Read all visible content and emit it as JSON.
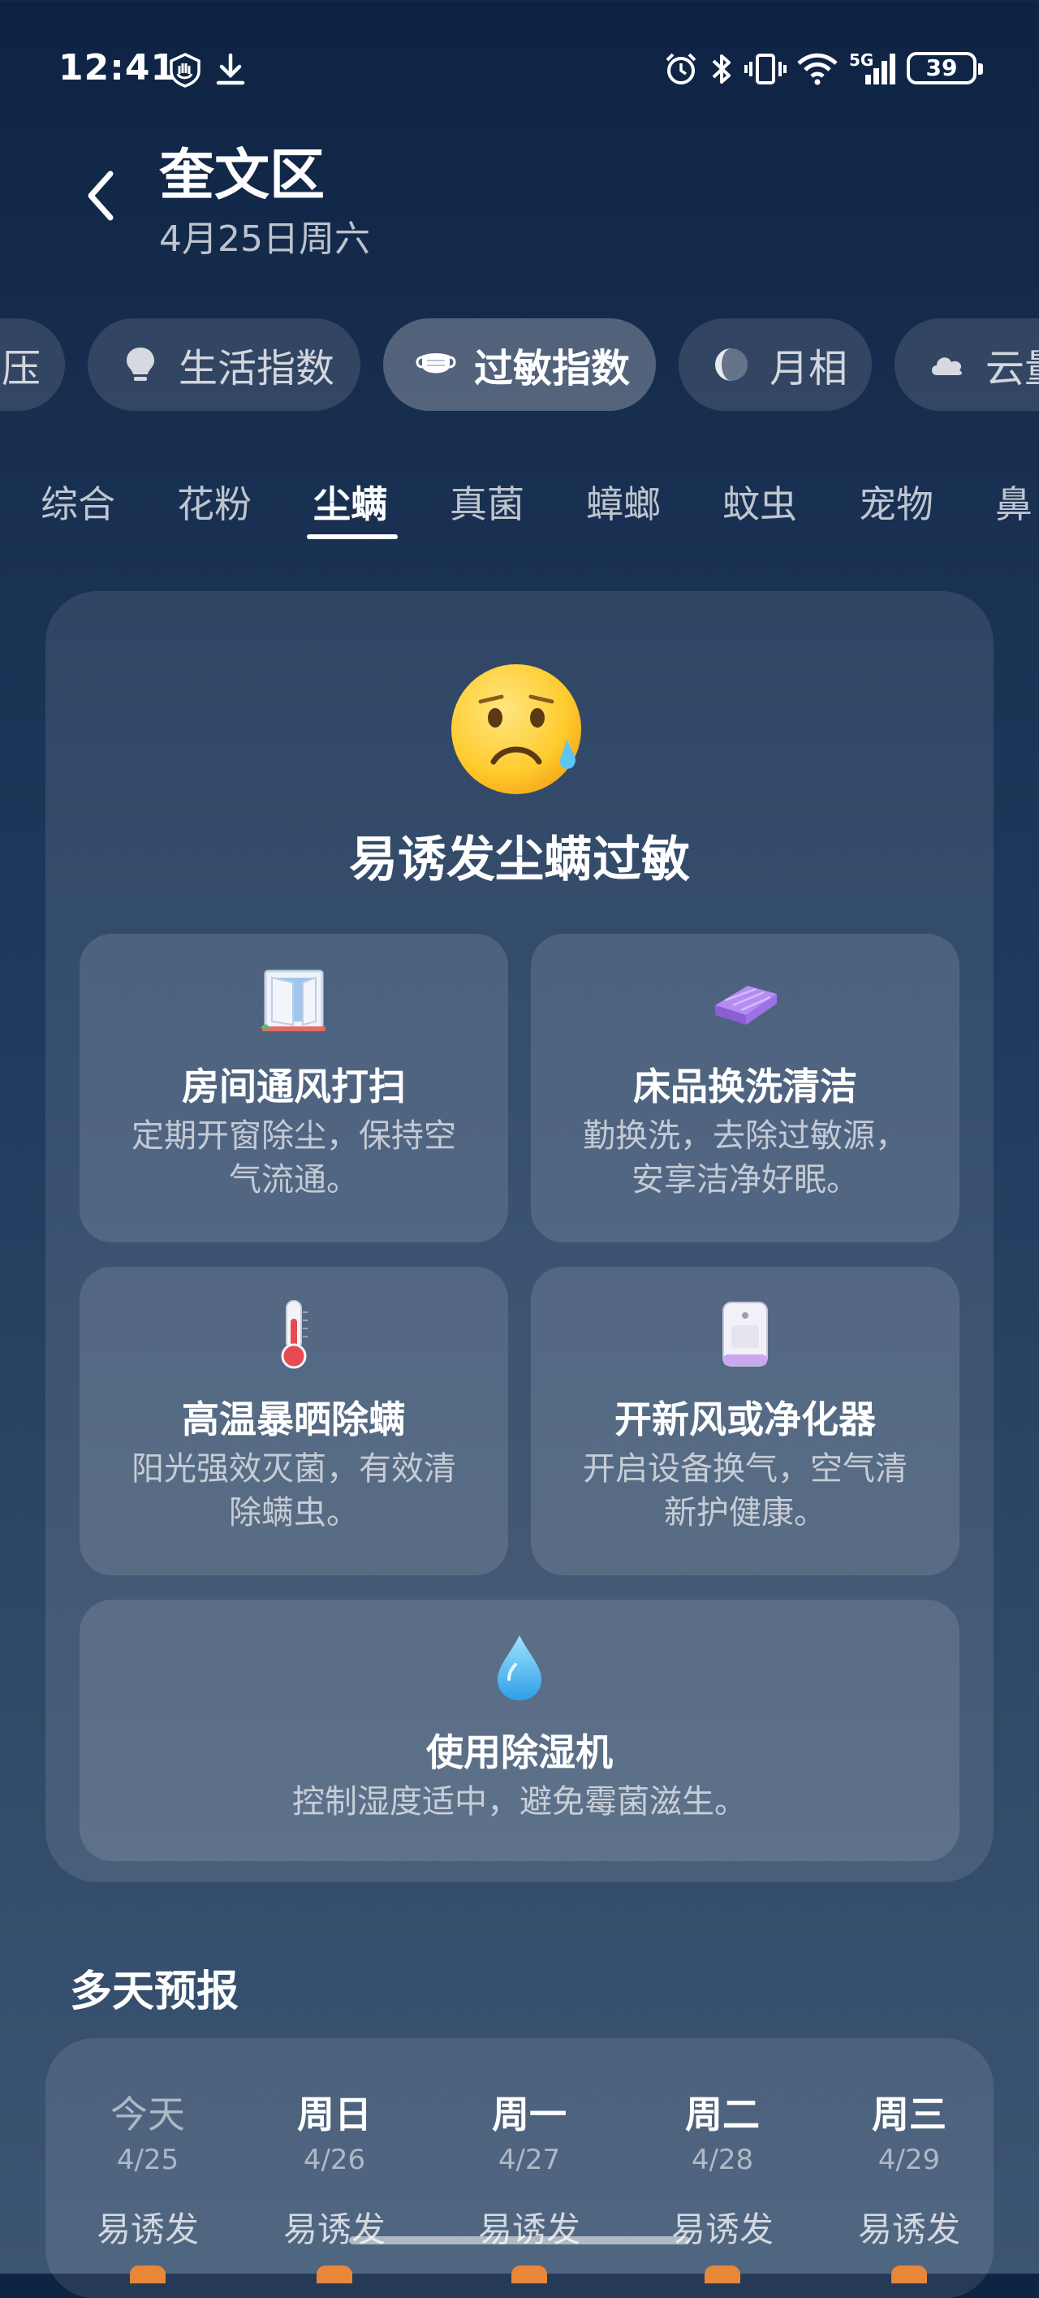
{
  "status_bar": {
    "time": "12:41",
    "network": "5G",
    "battery": "39"
  },
  "header": {
    "city": "奎文区",
    "date": "4月25日周六"
  },
  "index_chips": [
    {
      "label": "压",
      "icon": "pressure-icon"
    },
    {
      "label": "生活指数",
      "icon": "lightbulb-icon"
    },
    {
      "label": "过敏指数",
      "icon": "mask-icon"
    },
    {
      "label": "月相",
      "icon": "moon-phase-icon"
    },
    {
      "label": "云量",
      "icon": "cloud-icon"
    }
  ],
  "sub_tabs": [
    "综合",
    "花粉",
    "尘螨",
    "真菌",
    "蟑螂",
    "蚊虫",
    "宠物",
    "鼻"
  ],
  "active_sub_tab": "尘螨",
  "main_card": {
    "emoji": "worried-sweat-face-emoji",
    "headline": "易诱发尘螨过敏",
    "tips": [
      {
        "icon": "window-icon",
        "title": "房间通风打扫",
        "desc": "定期开窗除尘，保持空气流通。"
      },
      {
        "icon": "folded-blanket-icon",
        "title": "床品换洗清洁",
        "desc": "勤换洗，去除过敏源，安享洁净好眠。"
      },
      {
        "icon": "thermometer-icon",
        "title": "高温暴晒除螨",
        "desc": "阳光强效灭菌，有效清除螨虫。"
      },
      {
        "icon": "air-purifier-icon",
        "title": "开新风或净化器",
        "desc": "开启设备换气，空气清新护健康。"
      },
      {
        "icon": "water-drop-icon",
        "title": "使用除湿机",
        "desc": "控制湿度适中，避免霉菌滋生。"
      }
    ]
  },
  "forecast": {
    "title": "多天预报",
    "days": [
      {
        "day": "今天",
        "date": "4/25",
        "level": "易诱发"
      },
      {
        "day": "周日",
        "date": "4/26",
        "level": "易诱发"
      },
      {
        "day": "周一",
        "date": "4/27",
        "level": "易诱发"
      },
      {
        "day": "周二",
        "date": "4/28",
        "level": "易诱发"
      },
      {
        "day": "周三",
        "date": "4/29",
        "level": "易诱发"
      }
    ]
  },
  "colors": {
    "background_top": "#0e2344",
    "background_bottom": "#3c5573",
    "level_indicator": "#e8873a"
  }
}
